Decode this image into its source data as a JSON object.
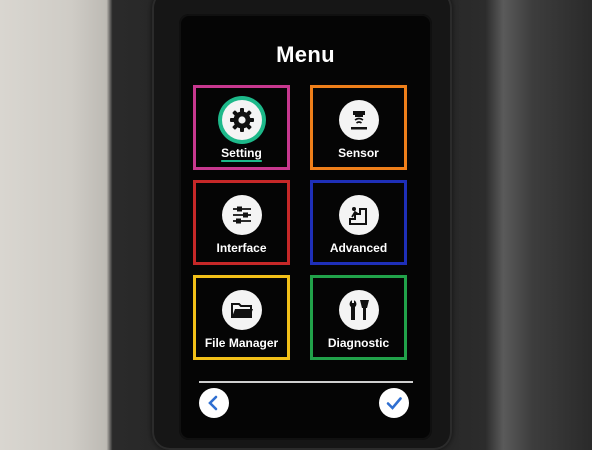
{
  "screen": {
    "title": "Menu"
  },
  "menu": {
    "items": [
      {
        "label": "Setting",
        "icon": "gear-icon",
        "border_color": "#c8388f",
        "selected": true
      },
      {
        "label": "Sensor",
        "icon": "sensor-icon",
        "border_color": "#ef7f1a",
        "selected": false
      },
      {
        "label": "Interface",
        "icon": "sliders-icon",
        "border_color": "#c62828",
        "selected": false
      },
      {
        "label": "Advanced",
        "icon": "stairs-icon",
        "border_color": "#1e2fb8",
        "selected": false
      },
      {
        "label": "File Manager",
        "icon": "folder-icon",
        "border_color": "#f2c018",
        "selected": false
      },
      {
        "label": "Diagnostic",
        "icon": "tools-icon",
        "border_color": "#21a24a",
        "selected": false
      }
    ]
  },
  "navigation": {
    "back_icon": "chevron-left-icon",
    "confirm_icon": "checkmark-icon",
    "button_color": "#2f6fd1"
  },
  "selection_color": "#1db98a"
}
